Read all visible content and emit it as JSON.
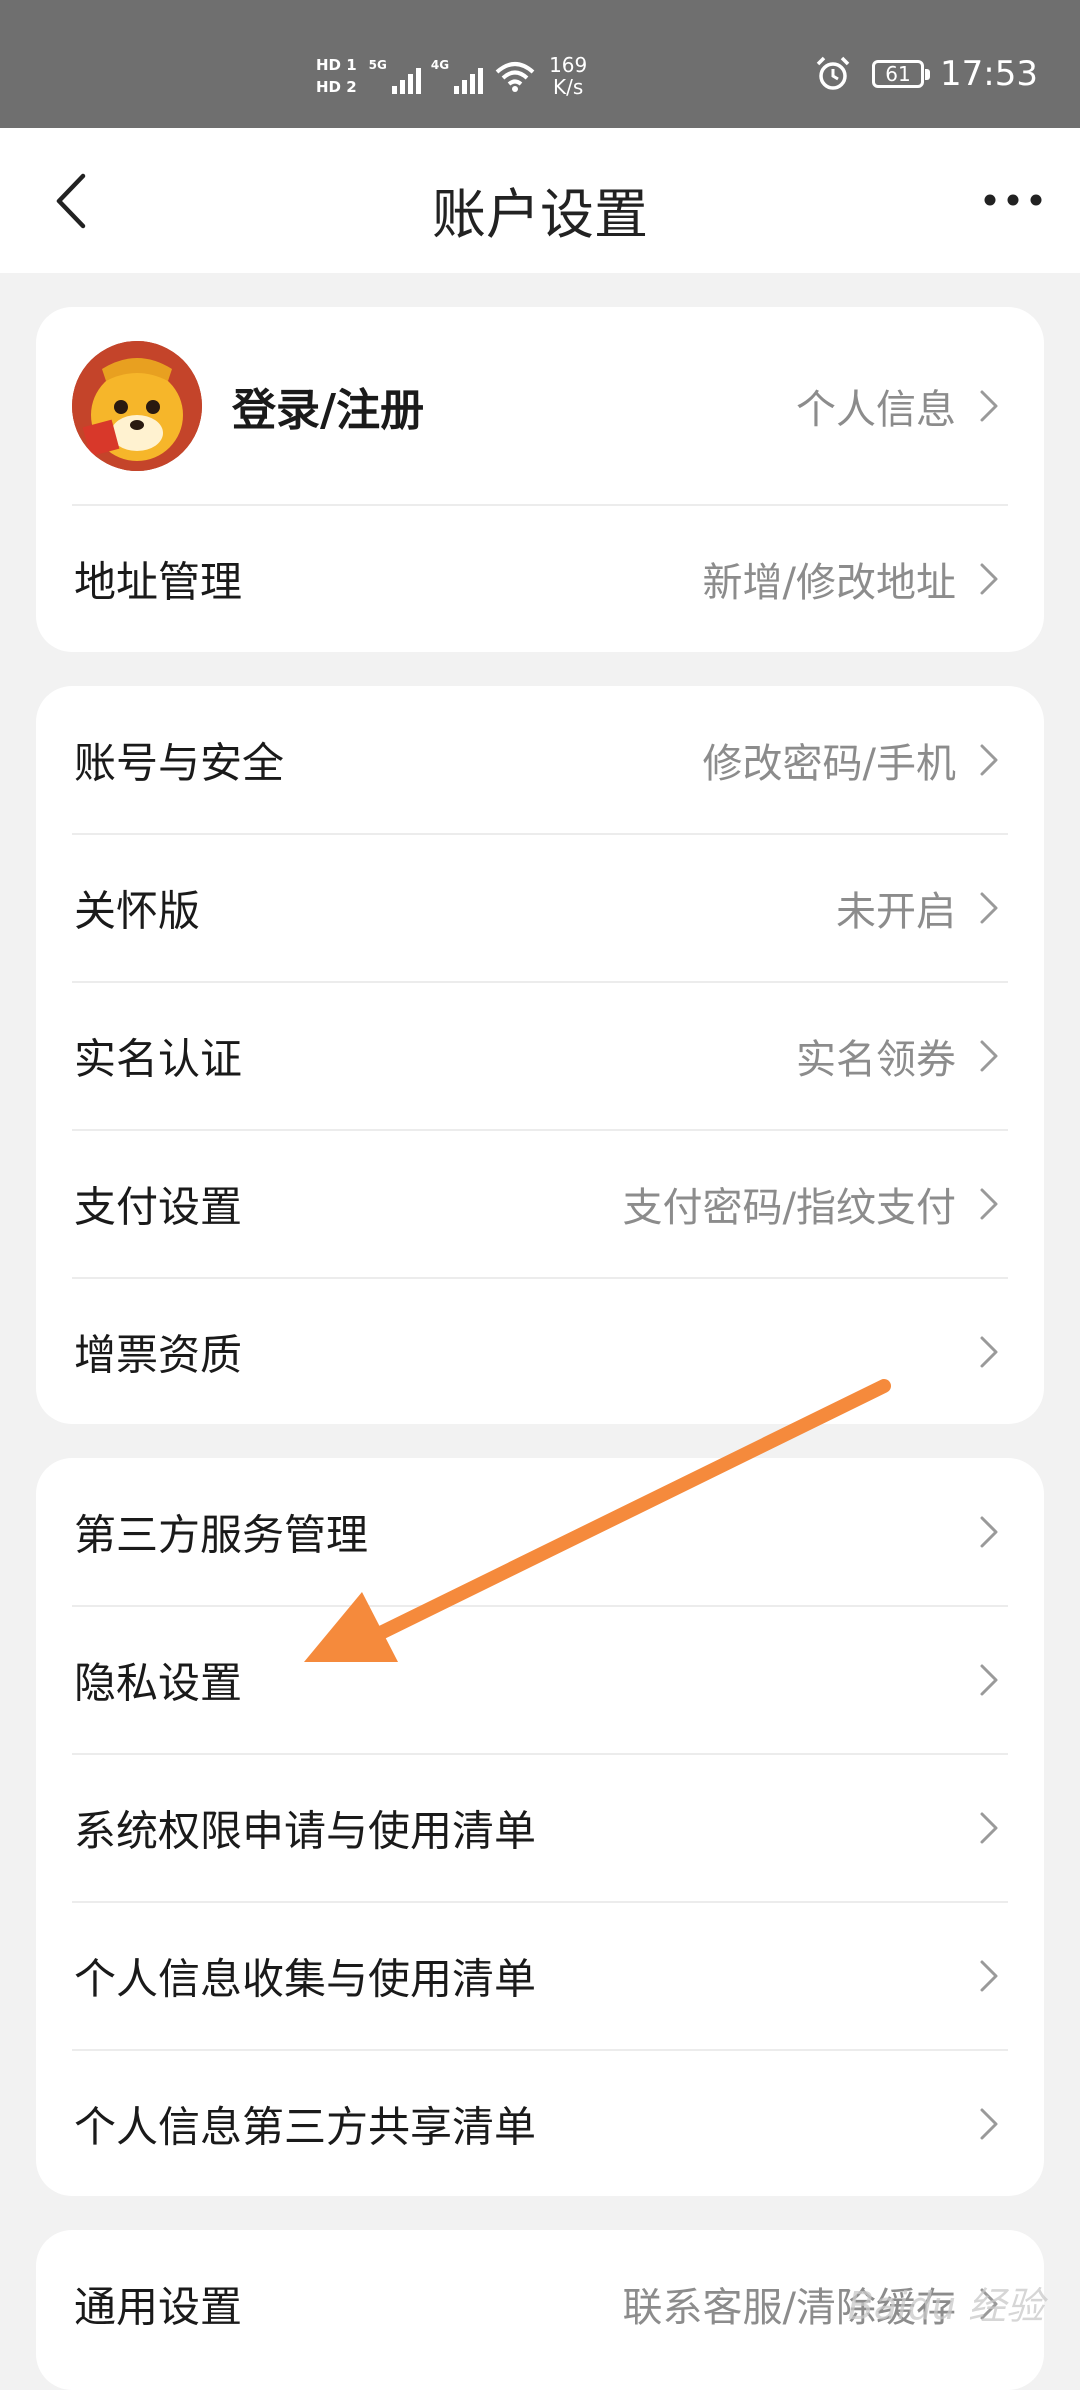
{
  "status_bar": {
    "hd1": "HD 1",
    "hd2": "HD 2",
    "sim1_network": "5G",
    "sim2_network": "4G",
    "net_speed_value": "169",
    "net_speed_unit": "K/s",
    "battery_level": "61",
    "time": "17:53"
  },
  "header": {
    "title": "账户设置",
    "back_icon": "chevron-left-icon",
    "more_icon": "more-horizontal-icon"
  },
  "profile_card": {
    "login_label": "登录/注册",
    "login_value": "个人信息",
    "address_label": "地址管理",
    "address_value": "新增/修改地址"
  },
  "account_card": {
    "items": [
      {
        "label": "账号与安全",
        "value": "修改密码/手机"
      },
      {
        "label": "关怀版",
        "value": "未开启"
      },
      {
        "label": "实名认证",
        "value": "实名领券"
      },
      {
        "label": "支付设置",
        "value": "支付密码/指纹支付"
      },
      {
        "label": "增票资质",
        "value": ""
      }
    ]
  },
  "privacy_card": {
    "items": [
      {
        "label": "第三方服务管理",
        "value": ""
      },
      {
        "label": "隐私设置",
        "value": ""
      },
      {
        "label": "系统权限申请与使用清单",
        "value": ""
      },
      {
        "label": "个人信息收集与使用清单",
        "value": ""
      },
      {
        "label": "个人信息第三方共享清单",
        "value": ""
      }
    ]
  },
  "general_card": {
    "items": [
      {
        "label": "通用设置",
        "value": "联系客服/清除缓存"
      }
    ]
  },
  "annotation": {
    "arrow_color": "#f58a3c"
  },
  "watermark": {
    "text": "Baidu 经验"
  },
  "colors": {
    "status_bar_bg": "#6f6f6f",
    "page_bg": "#f2f2f2",
    "card_bg": "#ffffff",
    "label_text": "#1a1a1a",
    "value_text": "#8c8c8c"
  }
}
